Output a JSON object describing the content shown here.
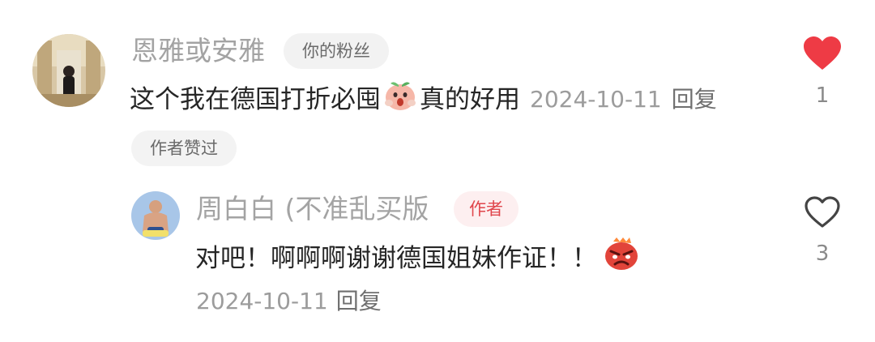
{
  "comment": {
    "username": "恩雅或安雅",
    "fan_tag": "你的粉丝",
    "text_before_emoji": "这个我在德国打折必囤",
    "emoji": "surprised-peach-emoji",
    "text_after_emoji": "真的好用",
    "date": "2024-10-11",
    "reply_label": "回复",
    "author_liked_badge": "作者赞过",
    "like_count": "1",
    "liked": true,
    "like_color": "#ee3b45"
  },
  "reply": {
    "username": "周白白 (不准乱买版",
    "author_tag": "作者",
    "text": "对吧！啊啊啊谢谢德国姐妹作证！！",
    "emoji": "angry-face-emoji",
    "date": "2024-10-11",
    "reply_label": "回复",
    "like_count": "3",
    "liked": false
  }
}
